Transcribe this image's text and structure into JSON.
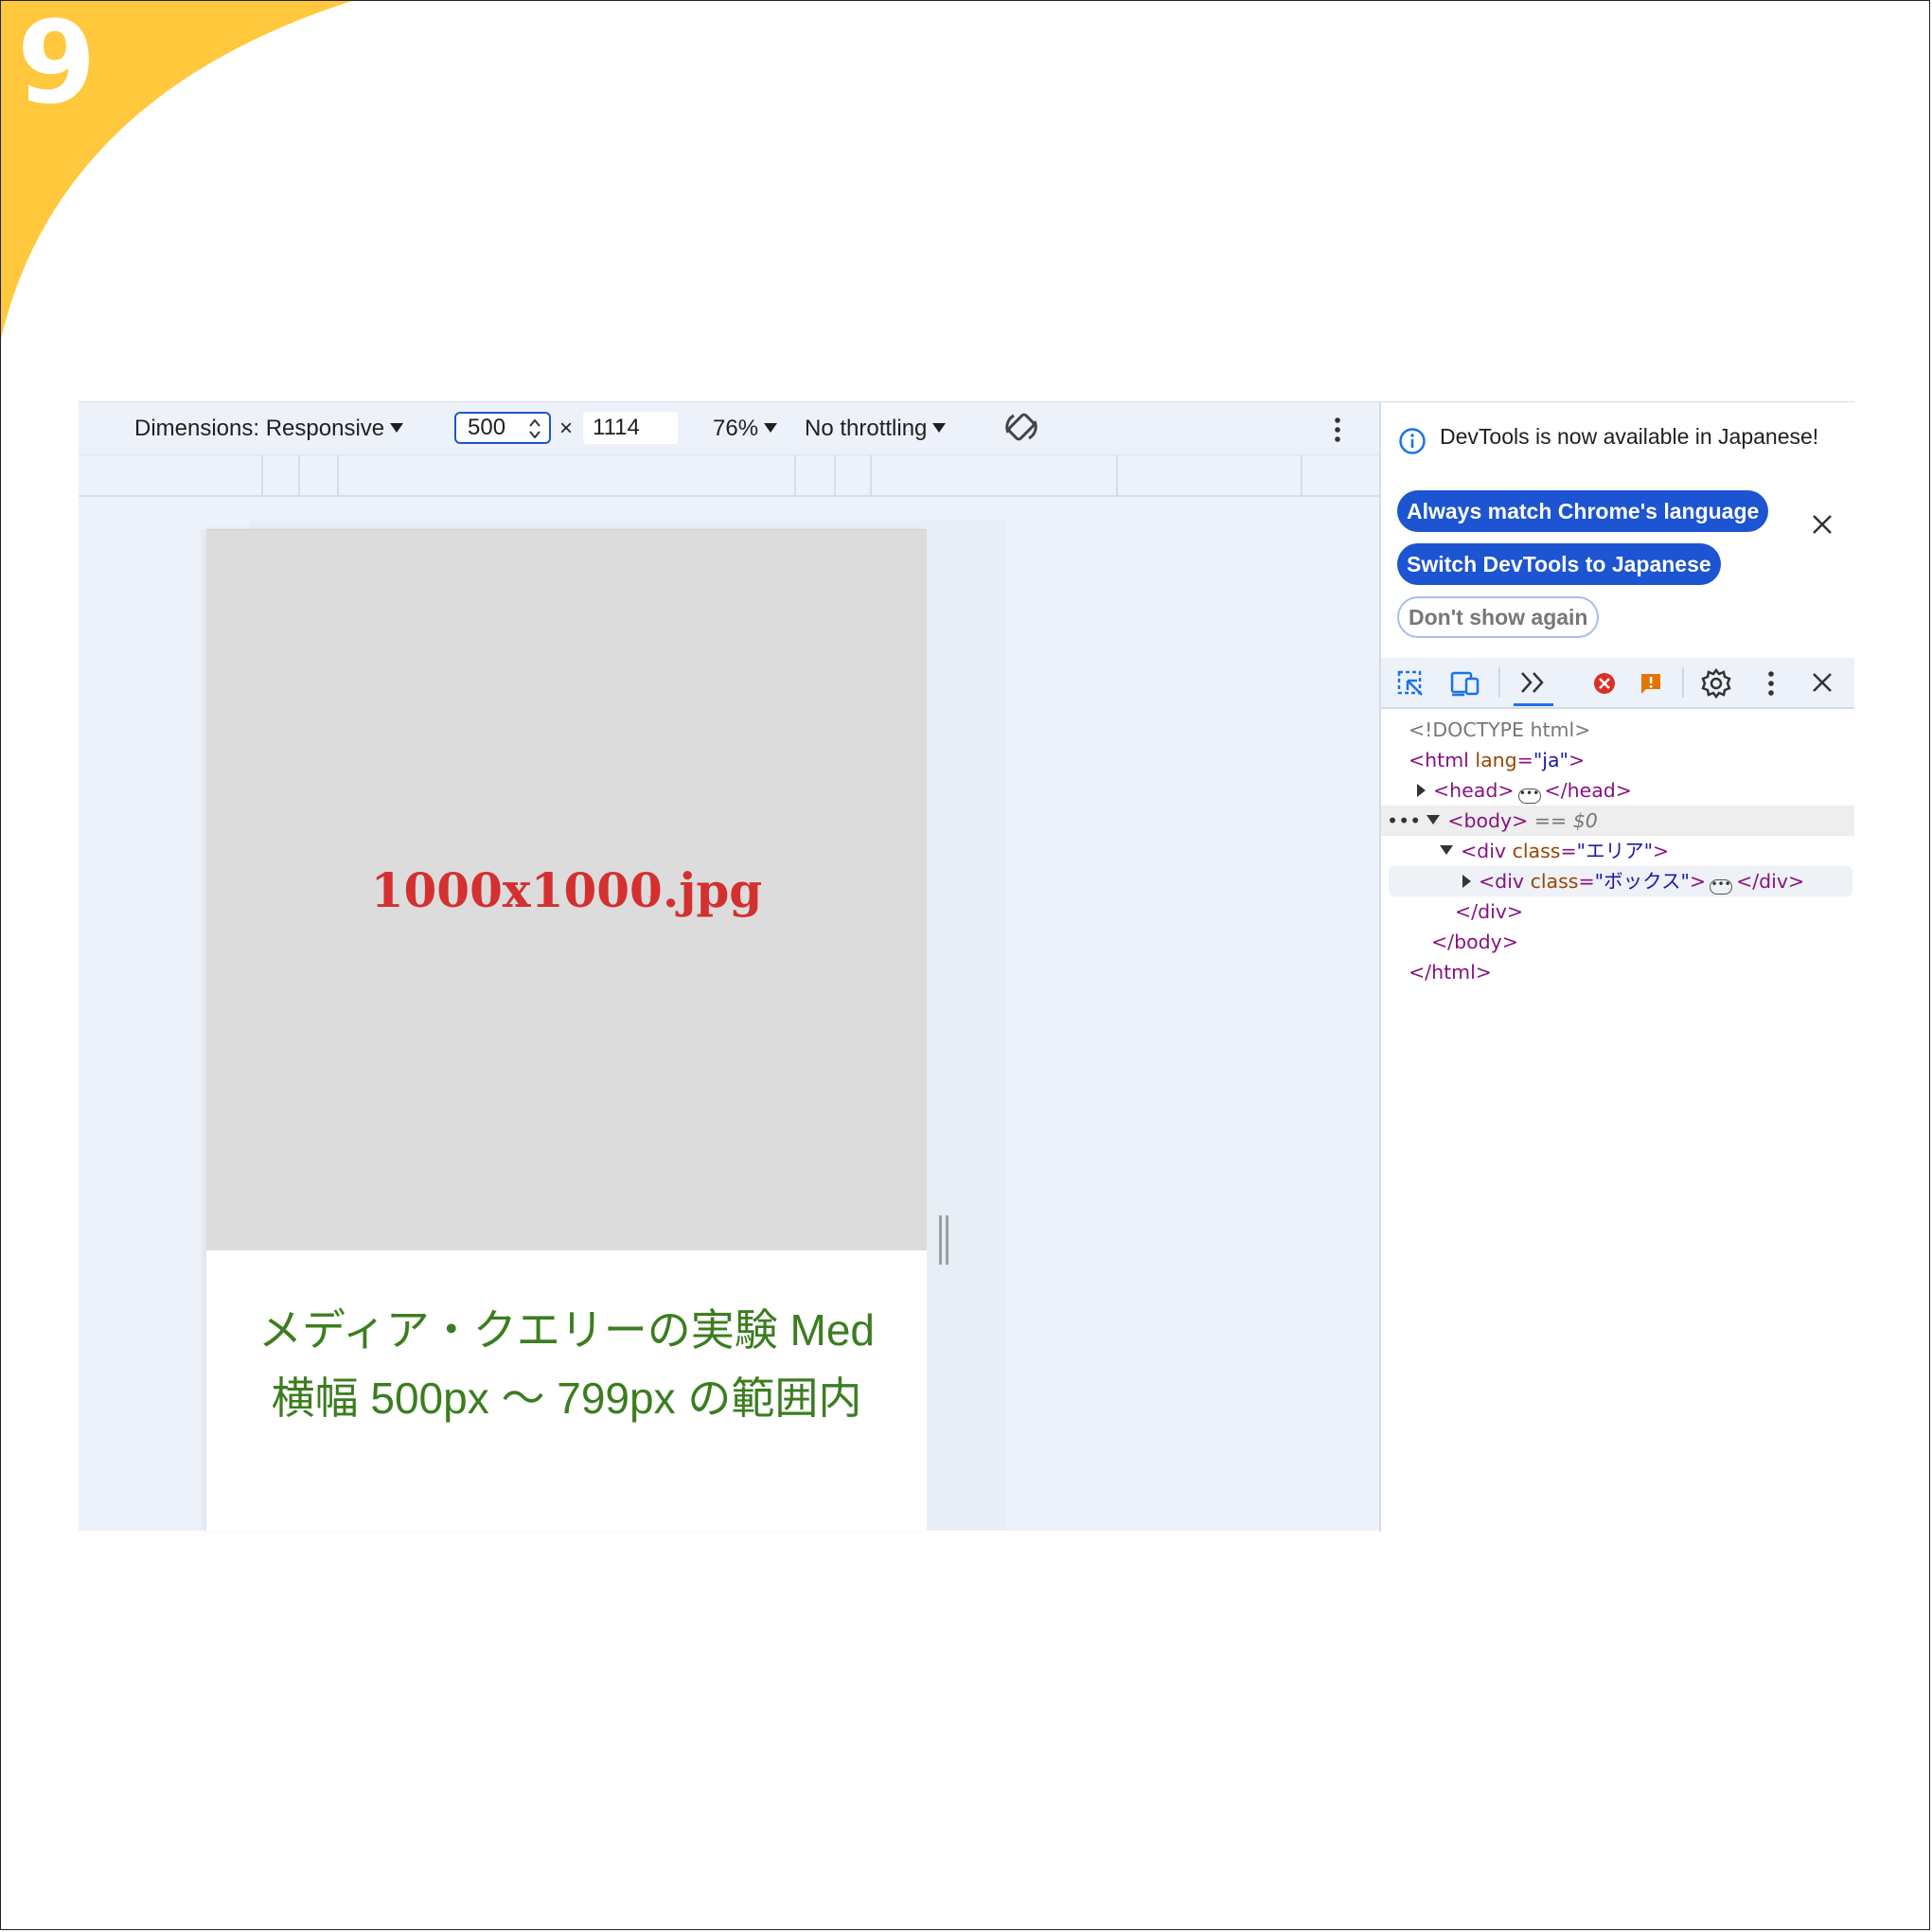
{
  "step_badge": {
    "number": "9",
    "accent": "#ffc83d"
  },
  "device_toolbar": {
    "dimensions_label": "Dimensions: Responsive",
    "width_value": "500",
    "times_symbol": "×",
    "height_value": "1114",
    "zoom": "76%",
    "throttling": "No throttling",
    "rotate_icon": "rotate-icon",
    "more_icon": "more-vertical-icon"
  },
  "viewport": {
    "image_placeholder_text": "1000x1000.jpg",
    "caption_line1": "メディア・クエリーの実験 Med",
    "caption_line2": "横幅 500px 〜 799px の範囲内",
    "caption_color": "#3b7d1f",
    "placeholder_text_color": "#d3302f"
  },
  "devtools": {
    "info_message": "DevTools is now available in Japanese!",
    "button_match": "Always match Chrome's language",
    "button_switch": "Switch DevTools to Japanese",
    "button_dont_show": "Don't show again",
    "accent": "#1c54d1",
    "toolbar_icons": [
      "inspect-element-icon",
      "device-toggle-icon",
      "more-panels-icon",
      "error-icon",
      "warning-icon",
      "settings-icon",
      "more-vertical-icon",
      "close-icon"
    ],
    "dom": {
      "doctype": "<!DOCTYPE html>",
      "html_open_tag": "<html",
      "html_lang_attr": "lang",
      "html_lang_val": "\"ja\"",
      "head_open": "<head>",
      "head_close": "</head>",
      "body_open": "<body>",
      "body_marker": "== $0",
      "div_area_open": "<div",
      "div_class_attr": "class",
      "div_area_val": "\"エリア\"",
      "div_box_val": "\"ボックス\"",
      "div_close": "</div>",
      "body_close": "</body>",
      "html_close": "</html>",
      "gt": ">",
      "eq": "="
    }
  }
}
